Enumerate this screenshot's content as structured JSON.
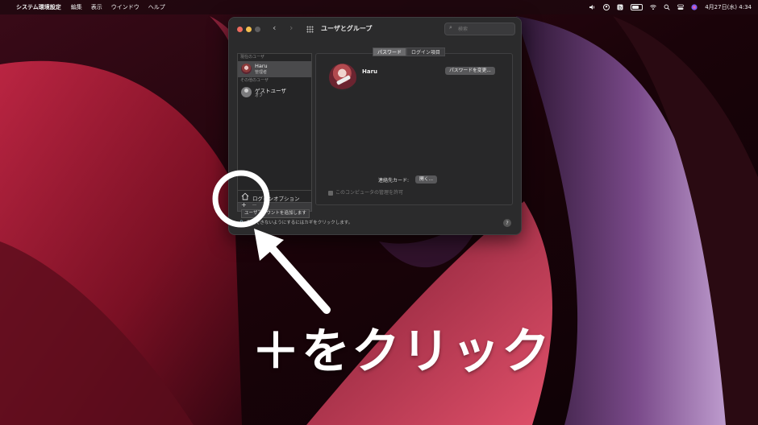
{
  "menubar": {
    "app": "システム環境設定",
    "menus": [
      "編集",
      "表示",
      "ウインドウ",
      "ヘルプ"
    ],
    "clock": "4月27日(水) 4:34"
  },
  "window": {
    "title": "ユーザとグループ",
    "search_placeholder": "検索",
    "current_users_label": "現在のユーザ",
    "other_users_label": "その他のユーザ",
    "users": [
      {
        "name": "Haru",
        "role": "管理者",
        "selected": true
      },
      {
        "name": "ゲストユーザ",
        "role": "オフ",
        "selected": false
      }
    ],
    "login_options_label": "ログインオプション",
    "plus": "+",
    "minus": "−",
    "tooltip": "ユーザアカウントを追加します",
    "lock_text": "変更できないようにするにはカギをクリックします。",
    "help": "?",
    "tabs": [
      "パスワード",
      "ログイン項目"
    ],
    "username": "Haru",
    "change_password_button": "パスワードを変更...",
    "contact_card_label": "連絡先カード:",
    "open_button": "開く...",
    "admin_checkbox": "このコンピュータの管理を許可"
  },
  "annotation": {
    "caption": "＋をクリック",
    "color": "#ffffff"
  }
}
